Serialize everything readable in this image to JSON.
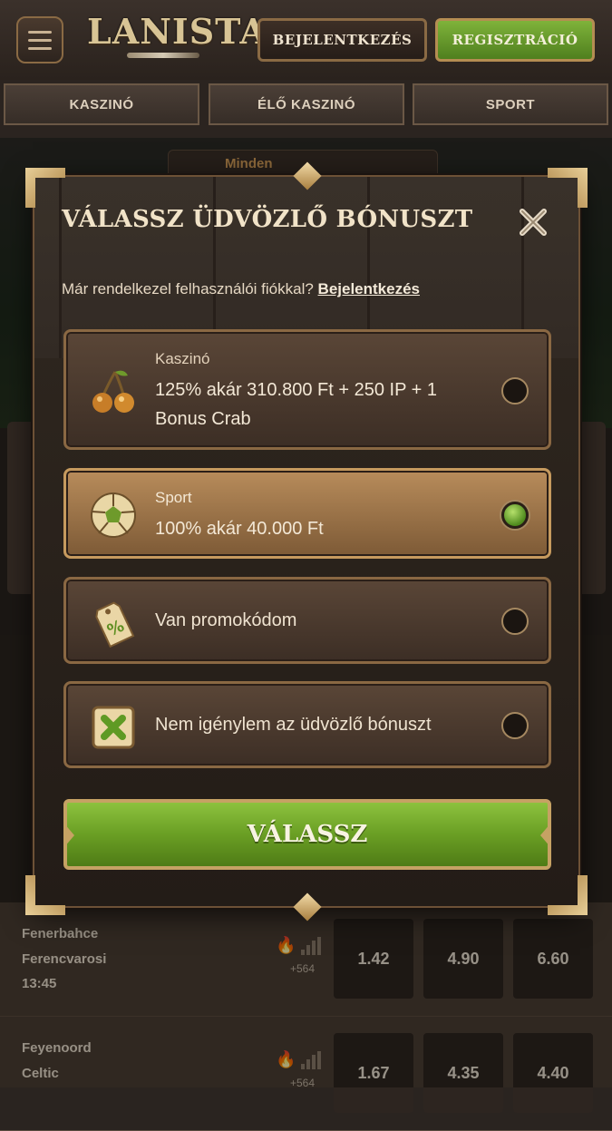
{
  "header": {
    "logo_text": "LANISTA",
    "login_button": "BEJELENTKEZÉS",
    "register_button": "REGISZTRÁCIÓ"
  },
  "nav": {
    "tabs": [
      {
        "label": "KASZINÓ"
      },
      {
        "label": "ÉLŐ KASZINÓ"
      },
      {
        "label": "SPORT"
      }
    ]
  },
  "background": {
    "filter_label": "Minden",
    "matches": [
      {
        "team1": "Fenerbahce",
        "team2": "Ferencvarosi",
        "time": "13:45",
        "count": "+564",
        "odds": [
          "1.42",
          "4.90",
          "6.60"
        ]
      },
      {
        "team1": "Feyenoord",
        "team2": "Celtic",
        "time": "",
        "count": "+564",
        "odds": [
          "1.67",
          "4.35",
          "4.40"
        ]
      }
    ]
  },
  "modal": {
    "title": "VÁLASSZ ÜDVÖZLŐ BÓNUSZT",
    "account_question": "Már rendelkezel felhasználói fiókkal?",
    "login_link": "Bejelentkezés",
    "options": [
      {
        "label": "Kaszinó",
        "title": "125% akár 310.800 Ft + 250 IP + 1 Bonus Crab",
        "icon": "cherries-icon",
        "selected": false
      },
      {
        "label": "Sport",
        "title": "100% akár 40.000 Ft",
        "icon": "soccer-ball-icon",
        "selected": true
      },
      {
        "label": "",
        "title": "Van promokódom",
        "icon": "promo-tag-icon",
        "selected": false
      },
      {
        "label": "",
        "title": "Nem igénylem az üdvözlő bónuszt",
        "icon": "cross-tile-icon",
        "selected": false
      }
    ],
    "cta": "VÁLASSZ"
  },
  "colors": {
    "accent_green": "#6a9f24",
    "gold_border": "#c6a264",
    "panel_bg": "#2a221d"
  }
}
